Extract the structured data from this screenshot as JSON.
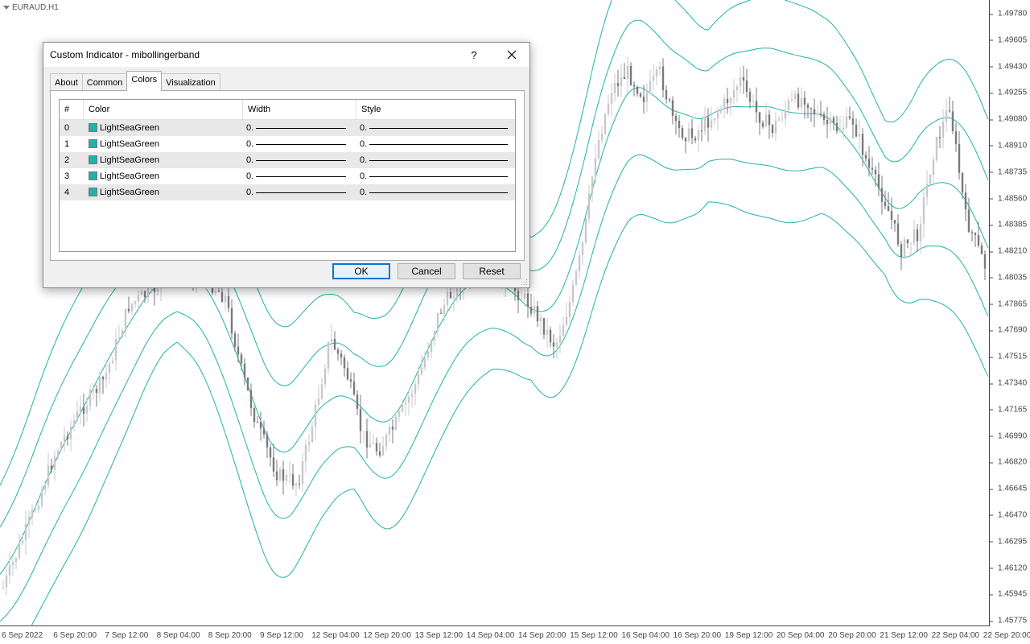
{
  "chart": {
    "symbol": "EURAUD,H1",
    "price_ticks": [
      "1.49780",
      "1.49605",
      "1.49430",
      "1.49255",
      "1.49080",
      "1.48910",
      "1.48735",
      "1.48560",
      "1.48385",
      "1.48210",
      "1.48035",
      "1.47865",
      "1.47690",
      "1.47515",
      "1.47340",
      "1.47165",
      "1.46990",
      "1.46820",
      "1.46645",
      "1.46470",
      "1.46295",
      "1.46120",
      "1.45945",
      "1.45775"
    ],
    "time_ticks": [
      "6 Sep 2022",
      "6 Sep 20:00",
      "7 Sep 12:00",
      "8 Sep 04:00",
      "8 Sep 20:00",
      "9 Sep 12:00",
      "12 Sep 04:00",
      "12 Sep 20:00",
      "13 Sep 12:00",
      "14 Sep 04:00",
      "14 Sep 20:00",
      "15 Sep 12:00",
      "16 Sep 04:00",
      "16 Sep 20:00",
      "19 Sep 12:00",
      "20 Sep 04:00",
      "20 Sep 20:00",
      "21 Sep 12:00",
      "22 Sep 04:00",
      "22 Sep 20:00"
    ],
    "band_color": "#20b2aa",
    "bull_candle_color": "#c8c8c8",
    "bear_candle_color": "#7a7a7a"
  },
  "dialog": {
    "title": "Custom Indicator - mibollingerband",
    "help_label": "?",
    "close_icon": "close-icon",
    "tabs": [
      {
        "label": "About"
      },
      {
        "label": "Common"
      },
      {
        "label": "Colors",
        "active": true
      },
      {
        "label": "Visualization"
      }
    ],
    "table": {
      "headers": [
        "#",
        "Color",
        "Width",
        "Style"
      ],
      "rows": [
        {
          "index": "0",
          "color_name": "LightSeaGreen",
          "color": "#20b2aa",
          "width": "0.",
          "style": "0."
        },
        {
          "index": "1",
          "color_name": "LightSeaGreen",
          "color": "#20b2aa",
          "width": "0.",
          "style": "0."
        },
        {
          "index": "2",
          "color_name": "LightSeaGreen",
          "color": "#20b2aa",
          "width": "0.",
          "style": "0."
        },
        {
          "index": "3",
          "color_name": "LightSeaGreen",
          "color": "#20b2aa",
          "width": "0.",
          "style": "0."
        },
        {
          "index": "4",
          "color_name": "LightSeaGreen",
          "color": "#20b2aa",
          "width": "0.",
          "style": "0."
        }
      ]
    },
    "buttons": {
      "ok": "OK",
      "cancel": "Cancel",
      "reset": "Reset"
    }
  }
}
